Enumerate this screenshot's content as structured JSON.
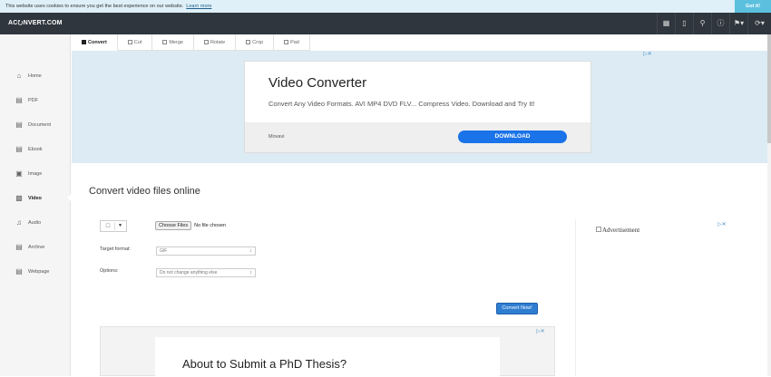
{
  "cookie": {
    "text": "This website uses cookies to ensure you get the best experience on our website.",
    "link": "Learn more",
    "button": "Got it!"
  },
  "navbar": {
    "logo": "AC⭮NVERT.COM",
    "icons": [
      "grid-icon",
      "mobile-icon",
      "search-icon",
      "help-icon",
      "bookmark-icon",
      "refresh-icon"
    ]
  },
  "sidebar": {
    "items": [
      {
        "label": "Home",
        "icon": "home-icon"
      },
      {
        "label": "PDF",
        "icon": "pdf-icon"
      },
      {
        "label": "Document",
        "icon": "document-icon"
      },
      {
        "label": "Ebook",
        "icon": "ebook-icon"
      },
      {
        "label": "Image",
        "icon": "image-icon"
      },
      {
        "label": "Video",
        "icon": "video-icon"
      },
      {
        "label": "Audio",
        "icon": "audio-icon"
      },
      {
        "label": "Archive",
        "icon": "archive-icon"
      },
      {
        "label": "Webpage",
        "icon": "webpage-icon"
      }
    ],
    "active": "Video"
  },
  "tabs": [
    "Convert",
    "Cut",
    "Merge",
    "Rotate",
    "Crop",
    "Pad"
  ],
  "ad1": {
    "title": "Video Converter",
    "text": "Convert Any Video Formats. AVI MP4 DVD FLV... Compress Video. Download and Try It!",
    "brand": "Movavi",
    "button": "DOWNLOAD"
  },
  "main": {
    "title": "Convert video files online"
  },
  "form": {
    "file_button": "Choose Files",
    "file_status": "No file chosen",
    "target_label": "Target format:",
    "target_value": "GIF",
    "options_label": "Options:",
    "options_value": "Do not change anything else",
    "convert_button": "Convert Now!"
  },
  "side_ad": {
    "alt": "Advertisement"
  },
  "ad2": {
    "title": "About to Submit a PhD Thesis?"
  }
}
